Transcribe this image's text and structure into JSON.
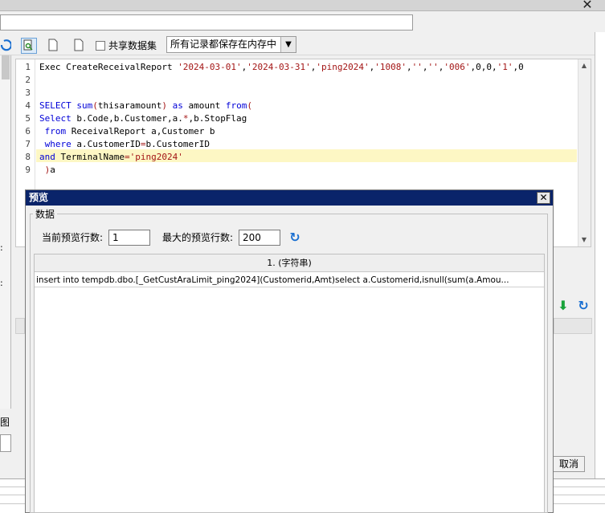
{
  "toolbar": {
    "share_dataset_label": "共享数据集",
    "cache_mode_value": "所有记录都保存在内存中"
  },
  "editor": {
    "line_numbers": [
      "1",
      "2",
      "3",
      "4",
      "5",
      "6",
      "7",
      "8",
      "9"
    ]
  },
  "left": {
    "tu_label": "图"
  },
  "dialog": {
    "title": "预览",
    "group_label": "数据",
    "current_rows_label": "当前预览行数:",
    "current_rows_value": "1",
    "max_rows_label": "最大的预览行数:",
    "max_rows_value": "200",
    "grid": {
      "column_header": "1. (字符串)",
      "cell_value": "insert into tempdb.dbo.[_GetCustAraLimit_ping2024](Customerid,Amt)select a.Customerid,isnull(sum(a.Amou..."
    }
  },
  "buttons": {
    "cancel_label": "取消"
  },
  "colors": {
    "dialog_title_bg": "#0a246a",
    "keyword": "#0000d8",
    "string": "#a31515",
    "highlight_line": "#fdf7c4"
  },
  "icons": {
    "refresh": "refresh-icon",
    "down": "green-down-arrow-icon"
  }
}
